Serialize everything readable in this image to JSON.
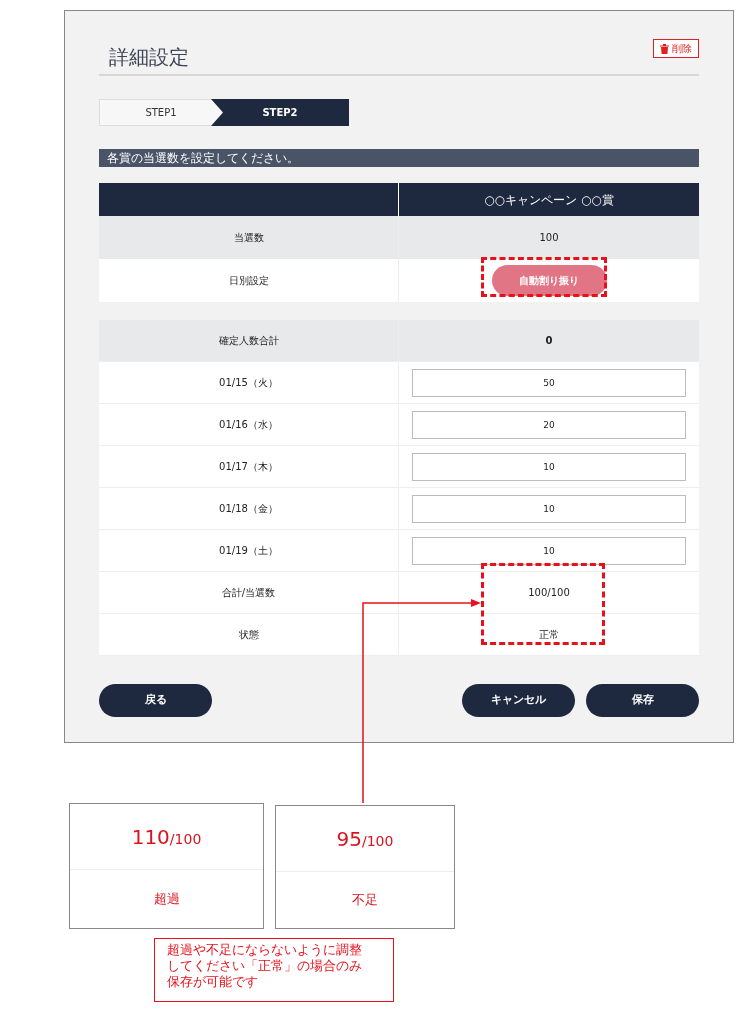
{
  "page": {
    "title": "詳細設定",
    "delete_button": "削除"
  },
  "steps": [
    {
      "label": "STEP1",
      "selected": false
    },
    {
      "label": "STEP2",
      "selected": true
    }
  ],
  "instruction": "各賞の当選数を設定してください。",
  "prize_table": {
    "header": "○○キャンペーン ○○賞",
    "rows": [
      {
        "kind": "text",
        "label": "当選数",
        "value": "100"
      },
      {
        "kind": "button",
        "label": "日別設定",
        "value": "自動割り振り"
      }
    ]
  },
  "daily_table": {
    "rows": [
      {
        "kind": "total",
        "label": "確定人数合計",
        "value": "0"
      },
      {
        "kind": "input",
        "label": "01/15（火）",
        "value": "50"
      },
      {
        "kind": "input",
        "label": "01/16（水）",
        "value": "20"
      },
      {
        "kind": "input",
        "label": "01/17（木）",
        "value": "10"
      },
      {
        "kind": "input",
        "label": "01/18（金）",
        "value": "10"
      },
      {
        "kind": "input",
        "label": "01/19（土）",
        "value": "10"
      },
      {
        "kind": "text",
        "label": "合計/当選数",
        "value": "100/100"
      },
      {
        "kind": "text",
        "label": "状態",
        "value": "正常"
      }
    ]
  },
  "footer": {
    "back": "戻る",
    "cancel": "キャンセル",
    "save": "保存"
  },
  "annotation": {
    "cards": [
      {
        "value": "110",
        "total": "/100",
        "label": "超過"
      },
      {
        "value": "95",
        "total": "/100",
        "label": "不足"
      }
    ],
    "note": "超過や不足にならないように調整してください「正常」の場合のみ保存が可能です"
  }
}
